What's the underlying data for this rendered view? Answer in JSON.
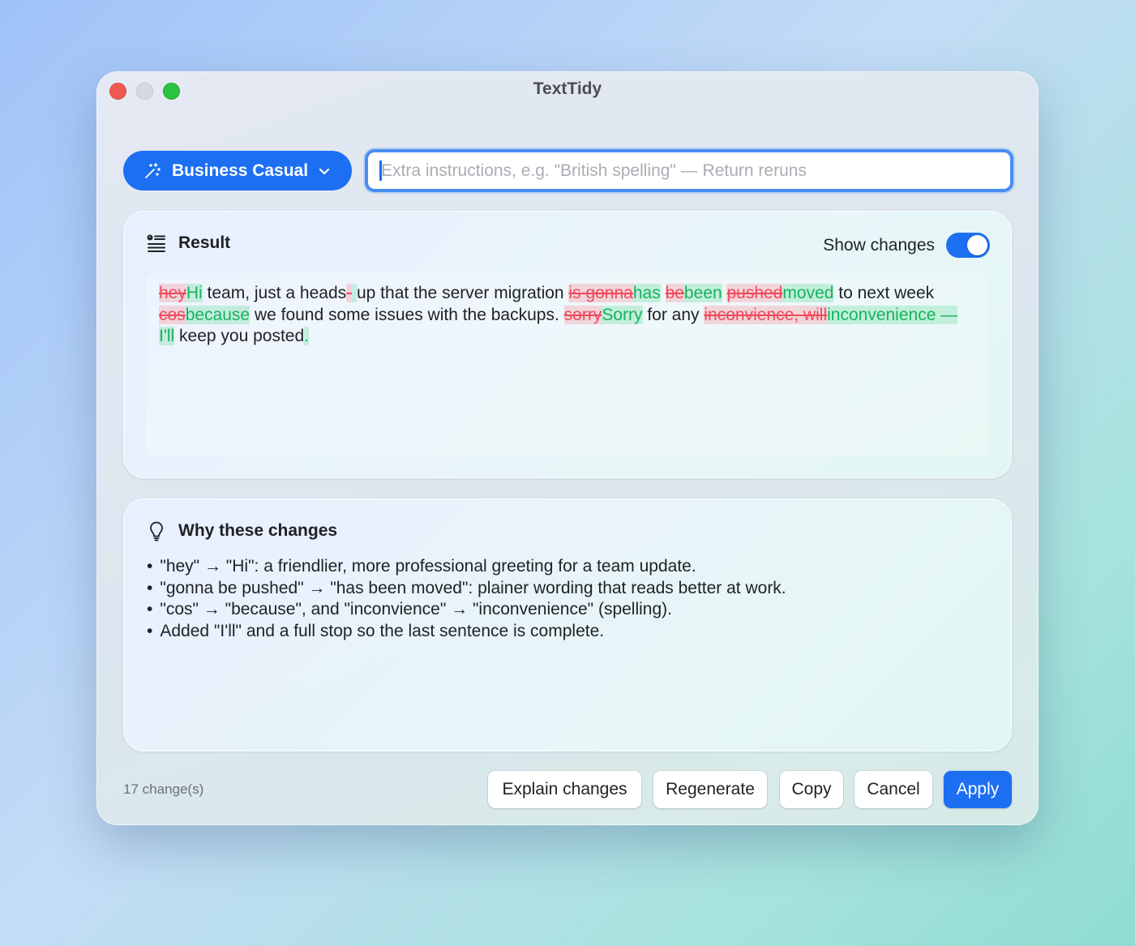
{
  "window": {
    "title": "TextTidy"
  },
  "toolbar": {
    "preset_label": "Business Casual",
    "instructions_placeholder": "Extra instructions, e.g. \"British spelling\" — Return reruns",
    "instructions_value": ""
  },
  "result": {
    "title": "Result",
    "show_changes_label": "Show changes",
    "show_changes_on": true,
    "segments": [
      {
        "t": "del",
        "v": "hey"
      },
      {
        "t": "ins",
        "v": "Hi"
      },
      {
        "t": "eq",
        "v": " team, just a heads"
      },
      {
        "t": "del",
        "v": "-"
      },
      {
        "t": "ins",
        "v": " "
      },
      {
        "t": "eq",
        "v": "up that the server migration "
      },
      {
        "t": "del",
        "v": "is gonna"
      },
      {
        "t": "ins",
        "v": "has"
      },
      {
        "t": "eq",
        "v": " "
      },
      {
        "t": "del",
        "v": "be"
      },
      {
        "t": "ins",
        "v": "been"
      },
      {
        "t": "eq",
        "v": " "
      },
      {
        "t": "del",
        "v": "pushed"
      },
      {
        "t": "ins",
        "v": "moved"
      },
      {
        "t": "eq",
        "v": " to next week "
      },
      {
        "t": "del",
        "v": "cos"
      },
      {
        "t": "ins",
        "v": "because"
      },
      {
        "t": "eq",
        "v": " we found some issues with the backups. "
      },
      {
        "t": "del",
        "v": "sorry"
      },
      {
        "t": "ins",
        "v": "Sorry"
      },
      {
        "t": "eq",
        "v": " for any "
      },
      {
        "t": "del",
        "v": "inconvience, will"
      },
      {
        "t": "ins",
        "v": "inconvenience — I'll"
      },
      {
        "t": "eq",
        "v": " keep you posted"
      },
      {
        "t": "ins",
        "v": "."
      }
    ]
  },
  "why": {
    "title": "Why these changes",
    "items": [
      "\"hey\" → \"Hi\": a friendlier, more professional greeting for a team update.",
      "\"gonna be pushed\" → \"has been moved\": plainer wording that reads better at work.",
      "\"cos\" → \"because\", and \"inconvience\" → \"inconvenience\" (spelling).",
      "Added \"I'll\" and a full stop so the last sentence is complete."
    ]
  },
  "footer": {
    "change_count": "17 change(s)",
    "explain_label": "Explain changes",
    "regenerate_label": "Regenerate",
    "copy_label": "Copy",
    "cancel_label": "Cancel",
    "apply_label": "Apply"
  },
  "colors": {
    "accent": "#1d6ff2",
    "deletion": "#ef4a5a",
    "insertion": "#15b35a"
  },
  "icons": {
    "preset": "magic-wand-icon",
    "preset_chevron": "chevron-down-icon",
    "result": "text-list-icon",
    "why": "lightbulb-icon"
  }
}
